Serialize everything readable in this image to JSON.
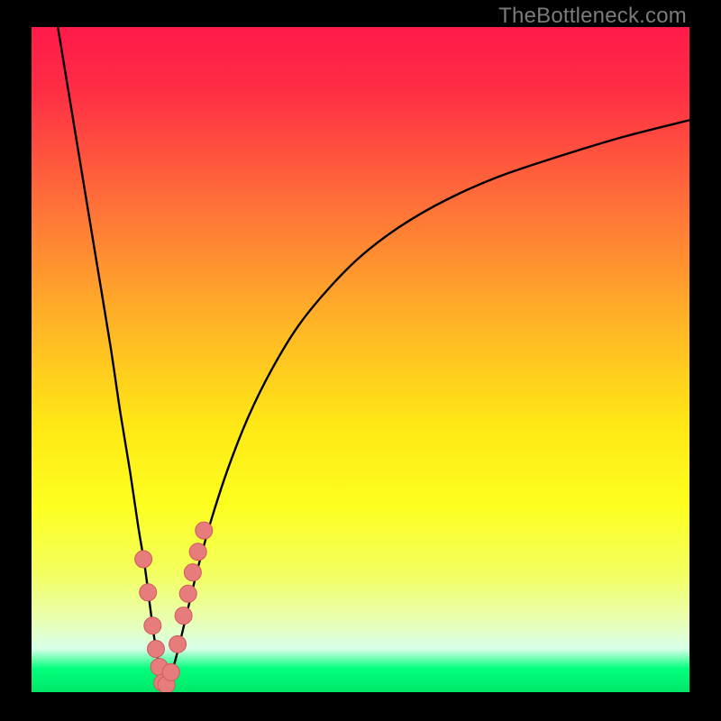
{
  "watermark": "TheBottleneck.com",
  "colors": {
    "frame": "#000000",
    "curve": "#000000",
    "marker_fill": "#e77c7d",
    "marker_stroke": "#cf5a5a",
    "gradient_stops": [
      {
        "offset": 0.0,
        "color": "#ff1a4a"
      },
      {
        "offset": 0.1,
        "color": "#ff2f44"
      },
      {
        "offset": 0.25,
        "color": "#ff6a3a"
      },
      {
        "offset": 0.45,
        "color": "#ffb626"
      },
      {
        "offset": 0.6,
        "color": "#ffe815"
      },
      {
        "offset": 0.72,
        "color": "#fdff20"
      },
      {
        "offset": 0.82,
        "color": "#f3ff5e"
      },
      {
        "offset": 0.89,
        "color": "#e9ffb0"
      },
      {
        "offset": 0.935,
        "color": "#d6ffe8"
      },
      {
        "offset": 0.965,
        "color": "#00ff7b"
      },
      {
        "offset": 1.0,
        "color": "#00e768"
      }
    ]
  },
  "chart_data": {
    "type": "line",
    "title": "",
    "xlabel": "",
    "ylabel": "",
    "xlim": [
      0,
      100
    ],
    "ylim": [
      0,
      100
    ],
    "series": [
      {
        "name": "bottleneck-curve",
        "x": [
          4,
          6,
          8,
          10,
          12,
          13.5,
          15,
          16.2,
          17.2,
          18,
          18.6,
          19.2,
          19.6,
          20,
          20.5,
          21,
          21.8,
          22.8,
          24,
          25.5,
          27.5,
          30,
          33,
          36.5,
          40.5,
          45,
          50,
          56,
          63,
          71,
          80,
          90,
          100
        ],
        "y": [
          100,
          88,
          76,
          64,
          52,
          42,
          33,
          25,
          19,
          13,
          8.5,
          5,
          2.6,
          1,
          1,
          2.2,
          4.6,
          8.5,
          13.5,
          19.5,
          26.5,
          34,
          41.5,
          48.5,
          55,
          60.5,
          65.5,
          70,
          74,
          77.5,
          80.5,
          83.5,
          86
        ]
      }
    ],
    "markers": {
      "name": "highlighted-points",
      "x": [
        17.0,
        17.7,
        18.4,
        18.9,
        19.4,
        19.9,
        20.5,
        21.2,
        22.2,
        23.1,
        23.8,
        24.5,
        25.3,
        26.2
      ],
      "y": [
        20.0,
        15.0,
        10.0,
        6.5,
        3.8,
        1.4,
        1.1,
        3.0,
        7.2,
        11.5,
        14.8,
        18.0,
        21.1,
        24.3
      ]
    }
  }
}
